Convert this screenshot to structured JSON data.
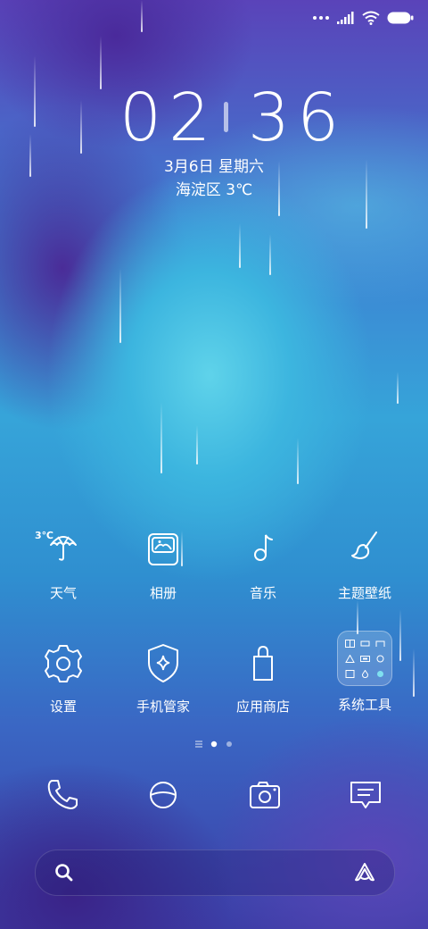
{
  "status_bar": {
    "icons": [
      "more-dots-icon",
      "signal-icon",
      "wifi-icon",
      "battery-icon"
    ]
  },
  "lockclock": {
    "hour": "02",
    "minute": "36",
    "date": "3月6日 星期六",
    "location_weather": "海淀区  3℃"
  },
  "apps": [
    {
      "label": "天气",
      "icon": "umbrella-weather-icon",
      "badge": "3℃"
    },
    {
      "label": "相册",
      "icon": "gallery-icon"
    },
    {
      "label": "音乐",
      "icon": "music-note-icon"
    },
    {
      "label": "主题壁纸",
      "icon": "paintbrush-icon"
    },
    {
      "label": "设置",
      "icon": "gear-icon"
    },
    {
      "label": "手机管家",
      "icon": "security-shield-icon"
    },
    {
      "label": "应用商店",
      "icon": "shopping-bag-icon"
    },
    {
      "label": "系统工具",
      "icon": "folder-icon"
    }
  ],
  "pager": {
    "pages": 3,
    "current": 2
  },
  "dock": [
    {
      "name": "phone",
      "icon": "phone-icon"
    },
    {
      "name": "browser",
      "icon": "browser-planet-icon"
    },
    {
      "name": "camera",
      "icon": "camera-icon"
    },
    {
      "name": "messages",
      "icon": "message-icon"
    }
  ],
  "search": {
    "icon": "search-icon",
    "assistant_icon": "assistant-icon"
  },
  "colors": {
    "accent_text": "#ffffff",
    "line_icon": "#ffffff"
  }
}
